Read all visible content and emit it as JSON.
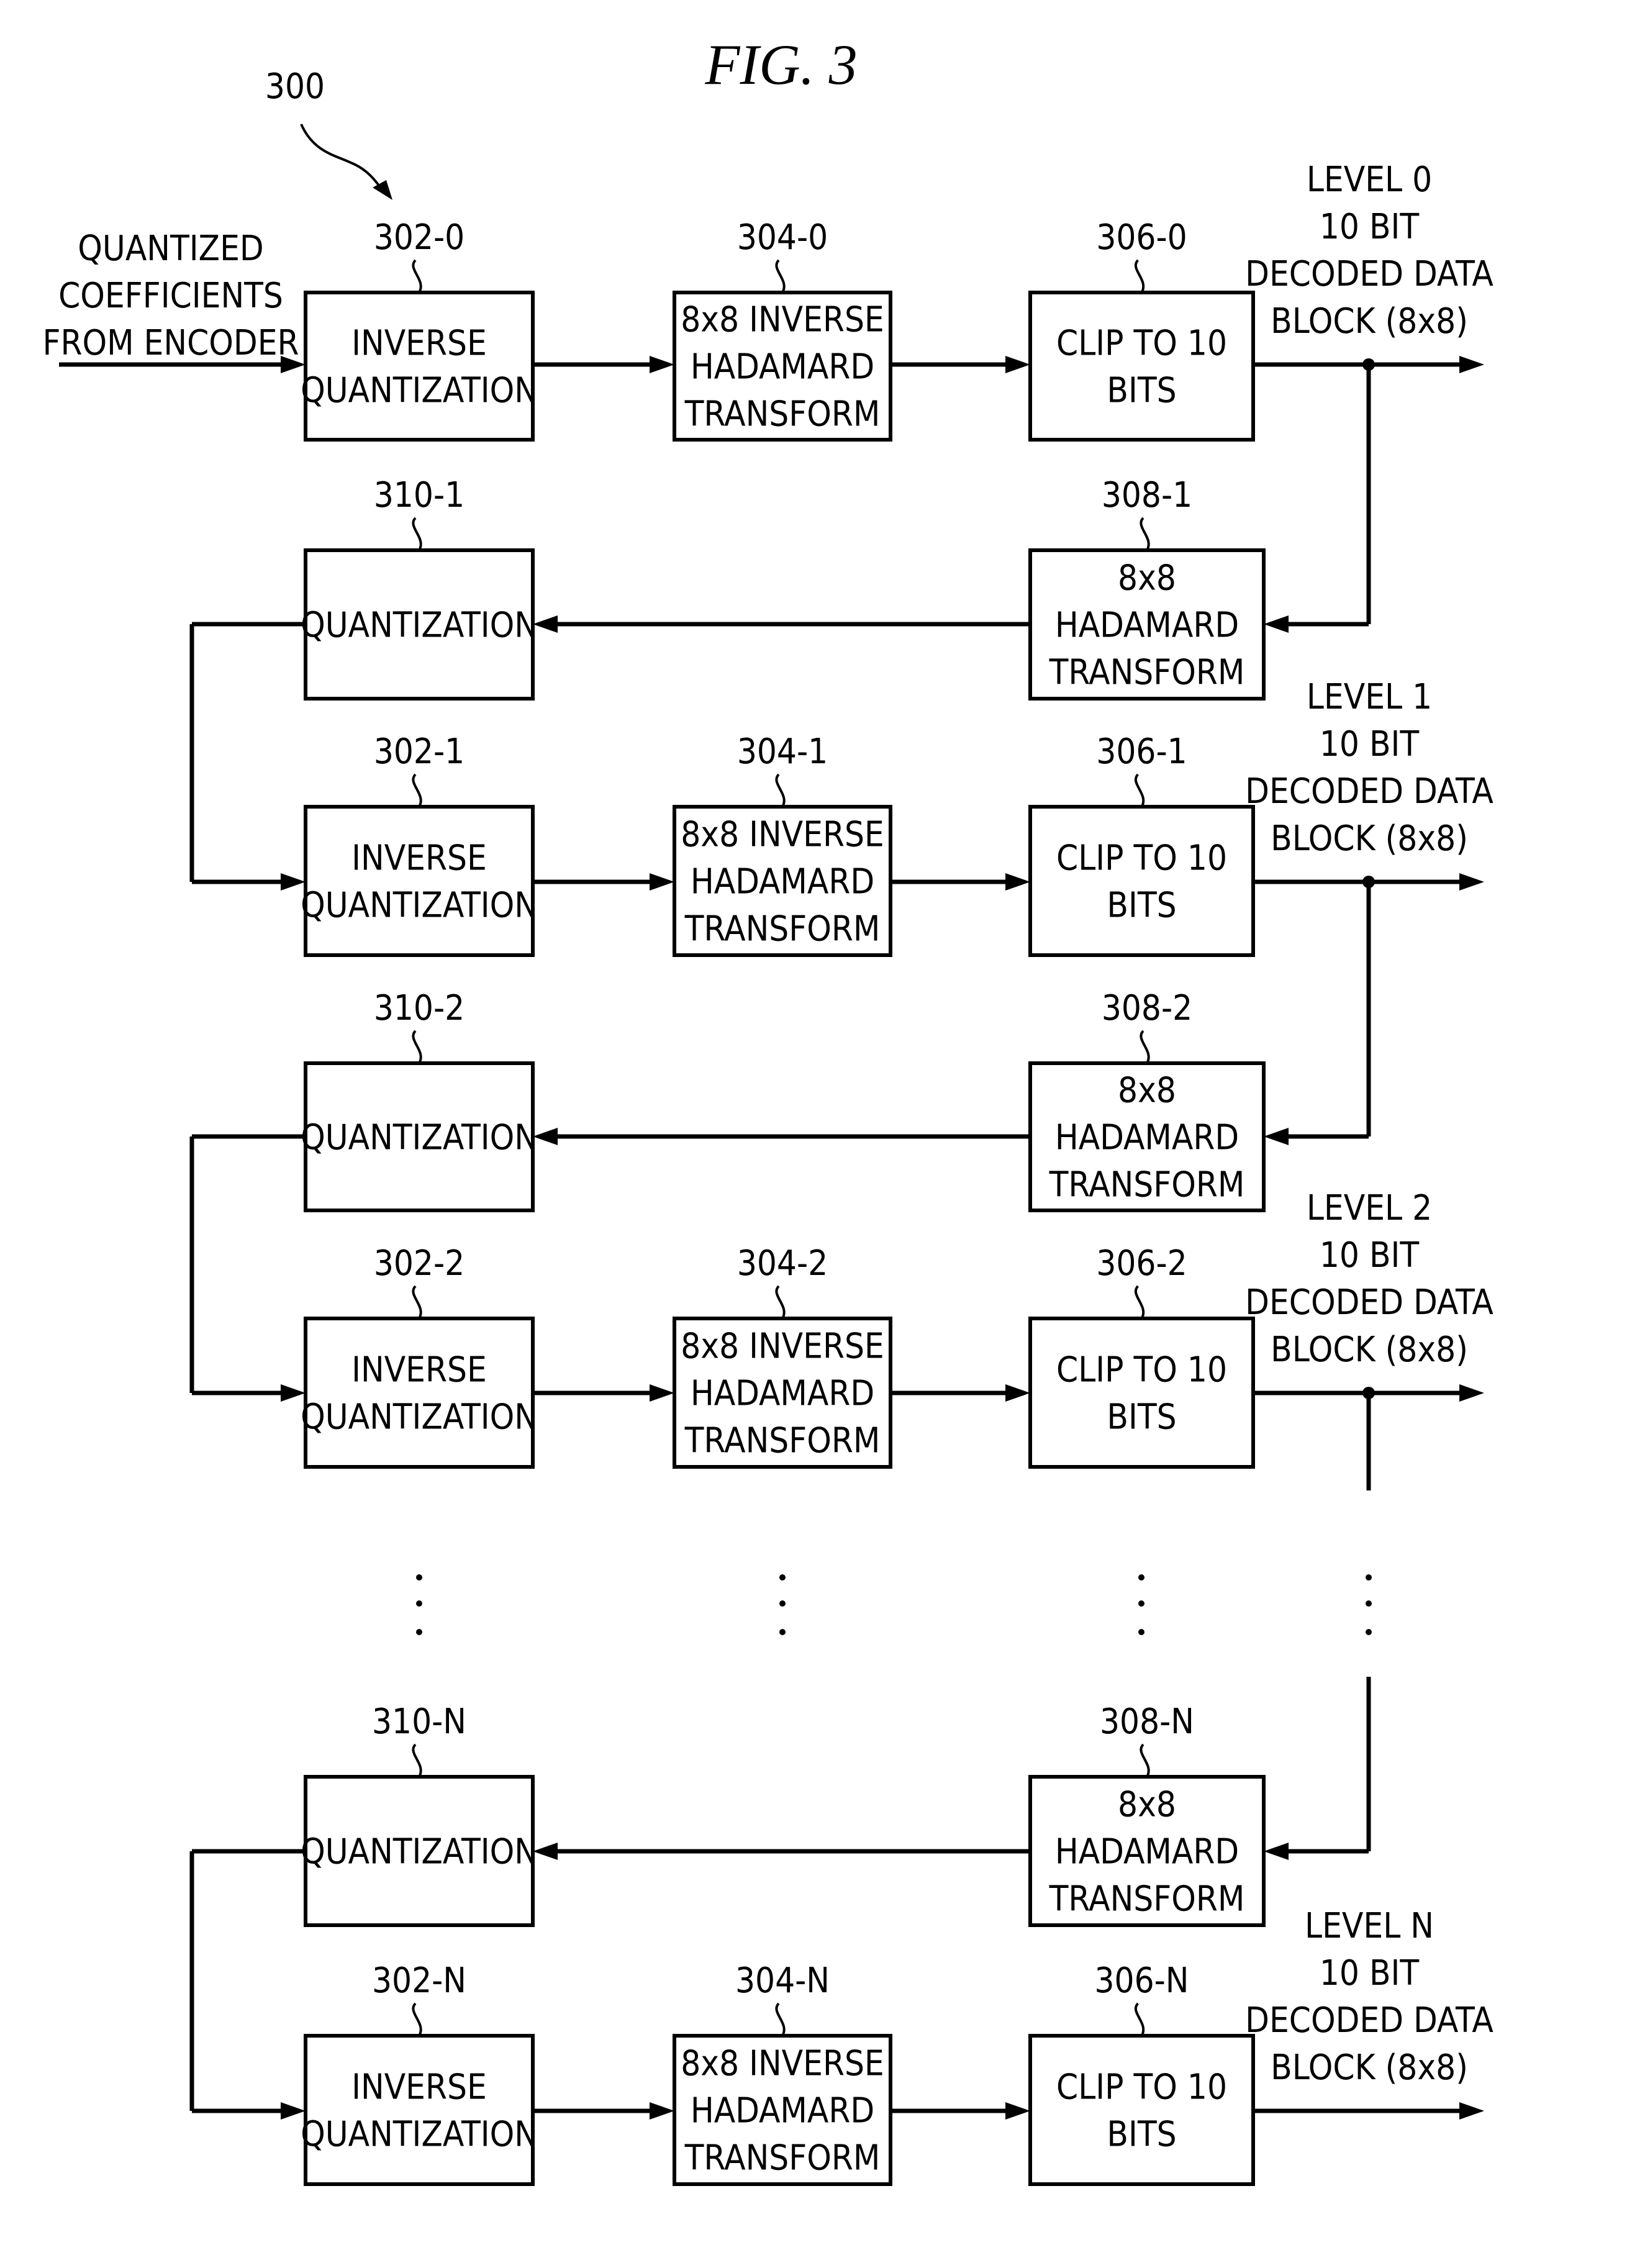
{
  "figure": {
    "title": "FIG. 3",
    "reference": "300"
  },
  "input_label": [
    "QUANTIZED",
    "COEFFICIENTS",
    "FROM ENCODER"
  ],
  "levels": [
    {
      "level": "0",
      "output_label": [
        "LEVEL 0",
        "10 BIT",
        "DECODED DATA",
        "BLOCK (8x8)"
      ],
      "feedback": {
        "hadamard": {
          "ref": "308-1",
          "text": [
            "8x8",
            "HADAMARD",
            "TRANSFORM"
          ]
        },
        "quant": {
          "ref": "310-1",
          "text": [
            "QUANTIZATION"
          ]
        }
      },
      "inv_quant": {
        "ref": "302-0",
        "text": [
          "INVERSE",
          "QUANTIZATION"
        ]
      },
      "inv_hadamard": {
        "ref": "304-0",
        "text": [
          "8x8 INVERSE",
          "HADAMARD",
          "TRANSFORM"
        ]
      },
      "clip": {
        "ref": "306-0",
        "text": [
          "CLIP TO 10",
          "BITS"
        ]
      }
    },
    {
      "level": "1",
      "output_label": [
        "LEVEL 1",
        "10 BIT",
        "DECODED DATA",
        "BLOCK (8x8)"
      ],
      "feedback": {
        "hadamard": {
          "ref": "308-2",
          "text": [
            "8x8",
            "HADAMARD",
            "TRANSFORM"
          ]
        },
        "quant": {
          "ref": "310-2",
          "text": [
            "QUANTIZATION"
          ]
        }
      },
      "inv_quant": {
        "ref": "302-1",
        "text": [
          "INVERSE",
          "QUANTIZATION"
        ]
      },
      "inv_hadamard": {
        "ref": "304-1",
        "text": [
          "8x8 INVERSE",
          "HADAMARD",
          "TRANSFORM"
        ]
      },
      "clip": {
        "ref": "306-1",
        "text": [
          "CLIP TO 10",
          "BITS"
        ]
      }
    },
    {
      "level": "2",
      "output_label": [
        "LEVEL 2",
        "10 BIT",
        "DECODED DATA",
        "BLOCK (8x8)"
      ],
      "inv_quant": {
        "ref": "302-2",
        "text": [
          "INVERSE",
          "QUANTIZATION"
        ]
      },
      "inv_hadamard": {
        "ref": "304-2",
        "text": [
          "8x8 INVERSE",
          "HADAMARD",
          "TRANSFORM"
        ]
      },
      "clip": {
        "ref": "306-2",
        "text": [
          "CLIP TO 10",
          "BITS"
        ]
      }
    },
    {
      "level": "N",
      "output_label": [
        "LEVEL N",
        "10 BIT",
        "DECODED DATA",
        "BLOCK (8x8)"
      ],
      "feedback_in": {
        "hadamard": {
          "ref": "308-N",
          "text": [
            "8x8",
            "HADAMARD",
            "TRANSFORM"
          ]
        },
        "quant": {
          "ref": "310-N",
          "text": [
            "QUANTIZATION"
          ]
        }
      },
      "inv_quant": {
        "ref": "302-N",
        "text": [
          "INVERSE",
          "QUANTIZATION"
        ]
      },
      "inv_hadamard": {
        "ref": "304-N",
        "text": [
          "8x8 INVERSE",
          "HADAMARD",
          "TRANSFORM"
        ]
      },
      "clip": {
        "ref": "306-N",
        "text": [
          "CLIP TO 10",
          "BITS"
        ]
      }
    }
  ],
  "ellipsis": "⋮"
}
